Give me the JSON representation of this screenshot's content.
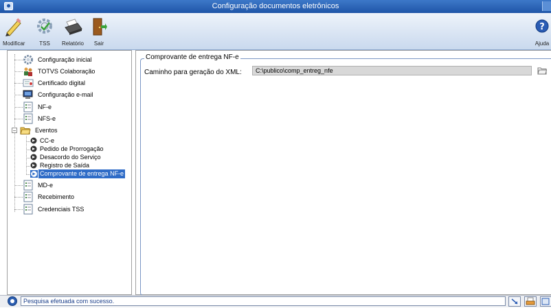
{
  "window": {
    "title": "Configuração documentos eletrônicos"
  },
  "toolbar": {
    "modificar": "Modificar",
    "tss": "TSS",
    "relatorio": "Relatório",
    "sair": "Sair",
    "ajuda": "Ajuda"
  },
  "tree": {
    "config_inicial": "Configuração inicial",
    "totvs_colab": "TOTVS Colaboração",
    "certificado": "Certificado digital",
    "config_email": "Configuração e-mail",
    "nfe": "NF-e",
    "nfse": "NFS-e",
    "eventos": "Eventos",
    "cce": "CC-e",
    "pedido": "Pedido de Prorrogação",
    "desacordo": "Desacordo do Serviço",
    "registro": "Registro de Saída",
    "comprovante": "Comprovante de entrega NF-e",
    "mde": "MD-e",
    "recebimento": "Recebimento",
    "credenciais": "Credenciais TSS"
  },
  "content": {
    "group_title": "Comprovante de entrega NF-e",
    "xml_label": "Caminho para geração do XML:",
    "xml_value": "C:\\publico\\comp_entreg_nfe"
  },
  "status": {
    "text": "Pesquisa efetuada com sucesso."
  },
  "colors": {
    "accent": "#2f6cc7",
    "titlebar": "#1f55a8"
  }
}
